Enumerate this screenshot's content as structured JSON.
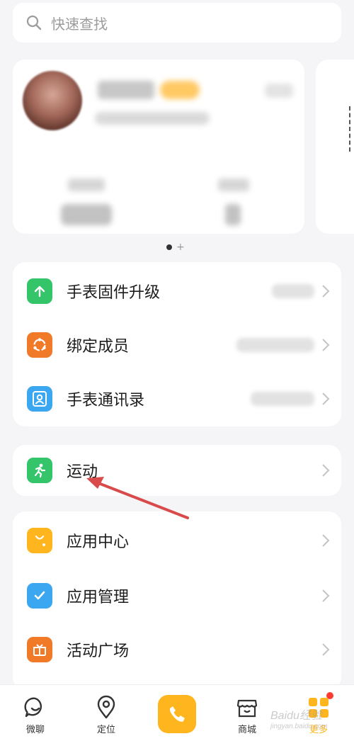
{
  "search": {
    "placeholder": "快速查找"
  },
  "profile": {
    "nickname": "",
    "subtitle": ""
  },
  "carousel": {
    "pages": 1
  },
  "device_list": {
    "items": [
      {
        "label": "手表固件升级",
        "icon": "upload-arrow-icon",
        "color": "#34c46a"
      },
      {
        "label": "绑定成员",
        "icon": "members-circle-icon",
        "color": "#f07a28"
      },
      {
        "label": "手表通讯录",
        "icon": "contact-book-icon",
        "color": "#3aa7f0"
      }
    ]
  },
  "sport": {
    "label": "运动",
    "icon": "running-person-icon",
    "color": "#34c46a"
  },
  "apps_list": {
    "items": [
      {
        "label": "应用中心",
        "icon": "shopping-bag-icon",
        "color": "#ffb51e"
      },
      {
        "label": "应用管理",
        "icon": "checkmark-ribbon-icon",
        "color": "#3aa7f0"
      },
      {
        "label": "活动广场",
        "icon": "gift-box-icon",
        "color": "#f07a28"
      }
    ]
  },
  "bottom_nav": {
    "items": [
      {
        "label": "微聊",
        "icon": "chat-bubble-icon"
      },
      {
        "label": "定位",
        "icon": "location-pin-icon"
      },
      {
        "label": "",
        "icon": "phone-icon"
      },
      {
        "label": "商城",
        "icon": "store-icon"
      },
      {
        "label": "更多",
        "icon": "grid-more-icon"
      }
    ]
  },
  "watermark": {
    "text": "Baidu经验",
    "sub": "jingyan.baidu.com"
  },
  "colors": {
    "accent": "#ffb51e",
    "annotation": "#d94a4a",
    "notification": "#ff3b30"
  }
}
